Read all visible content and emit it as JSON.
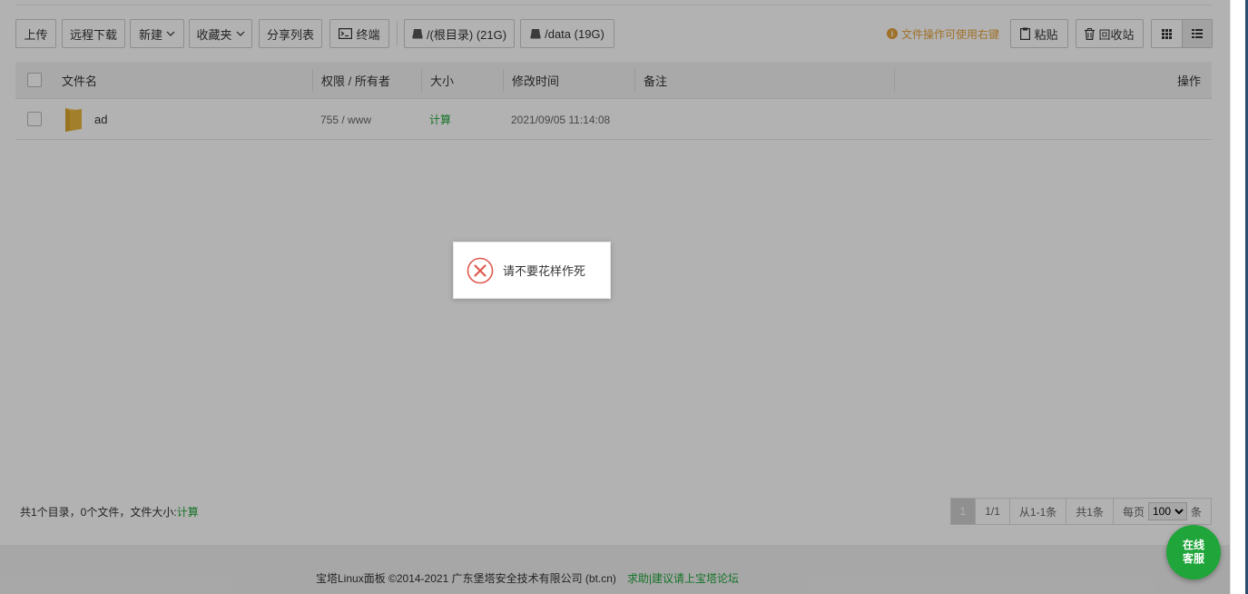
{
  "toolbar": {
    "upload": "上传",
    "remote_download": "远程下载",
    "new": "新建",
    "favorites": "收藏夹",
    "share_list": "分享列表",
    "terminal": "终端",
    "disk_root": "/(根目录) (21G)",
    "disk_data": "/data (19G)",
    "tip": "文件操作可使用右键",
    "paste": "粘贴",
    "recycle_bin": "回收站"
  },
  "table": {
    "columns": [
      "文件名",
      "权限 / 所有者",
      "大小",
      "修改时间",
      "备注",
      "操作"
    ],
    "rows": [
      {
        "name": "ad",
        "permission": "755 / www",
        "size": "计算",
        "modified": "2021/09/05 11:14:08",
        "note": ""
      }
    ]
  },
  "summary": {
    "text": "共1个目录，0个文件，文件大小:",
    "size_link": "计算"
  },
  "pager": {
    "current_page": "1",
    "pages": "1/1",
    "range": "从1-1条",
    "total": "共1条",
    "per_page_label": "每页",
    "per_page_value": "100",
    "per_page_unit": "条"
  },
  "footer": {
    "copyright": "宝塔Linux面板 ©2014-2021 广东堡塔安全技术有限公司 (bt.cn)",
    "help_link": "求助|建议请上宝塔论坛"
  },
  "toast": {
    "message": "请不要花样作死",
    "icon": "error-circle-icon"
  },
  "chat": {
    "line1": "在线",
    "line2": "客服"
  },
  "colors": {
    "accent_green": "#20a53a",
    "tip_orange": "#e6a23c",
    "error_red": "#e05a4e"
  }
}
